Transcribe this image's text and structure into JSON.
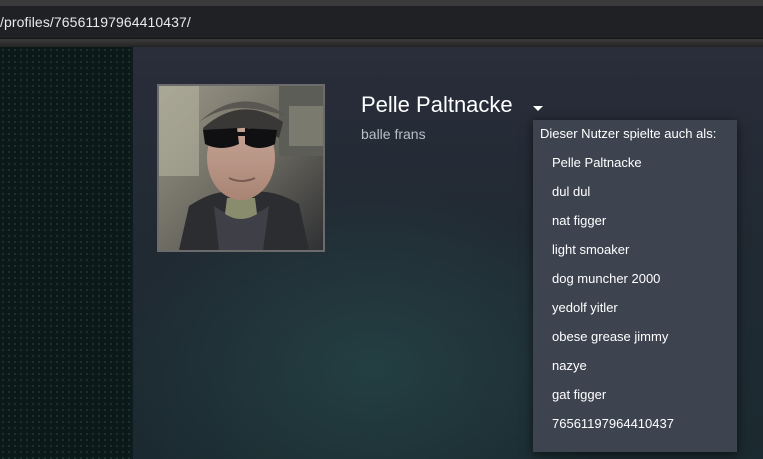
{
  "browser": {
    "address": "/profiles/76561197964410437/"
  },
  "profile": {
    "persona_name": "Pelle Paltnacke",
    "real_name": "balle frans",
    "avatar_icon": "user-avatar-photo"
  },
  "alias_popup": {
    "header": "Dieser Nutzer spielte auch als:",
    "items": [
      "Pelle Paltnacke",
      "dul dul",
      "nat figger",
      "light smoaker",
      "dog muncher 2000",
      "yedolf yitler",
      "obese grease jimmy",
      "nazye",
      "gat figger",
      "76561197964410437"
    ]
  },
  "colors": {
    "page_bg": "#1b2838",
    "popup_bg": "#3d4450",
    "text_primary": "#ffffff",
    "text_secondary": "#b8bfc7"
  }
}
